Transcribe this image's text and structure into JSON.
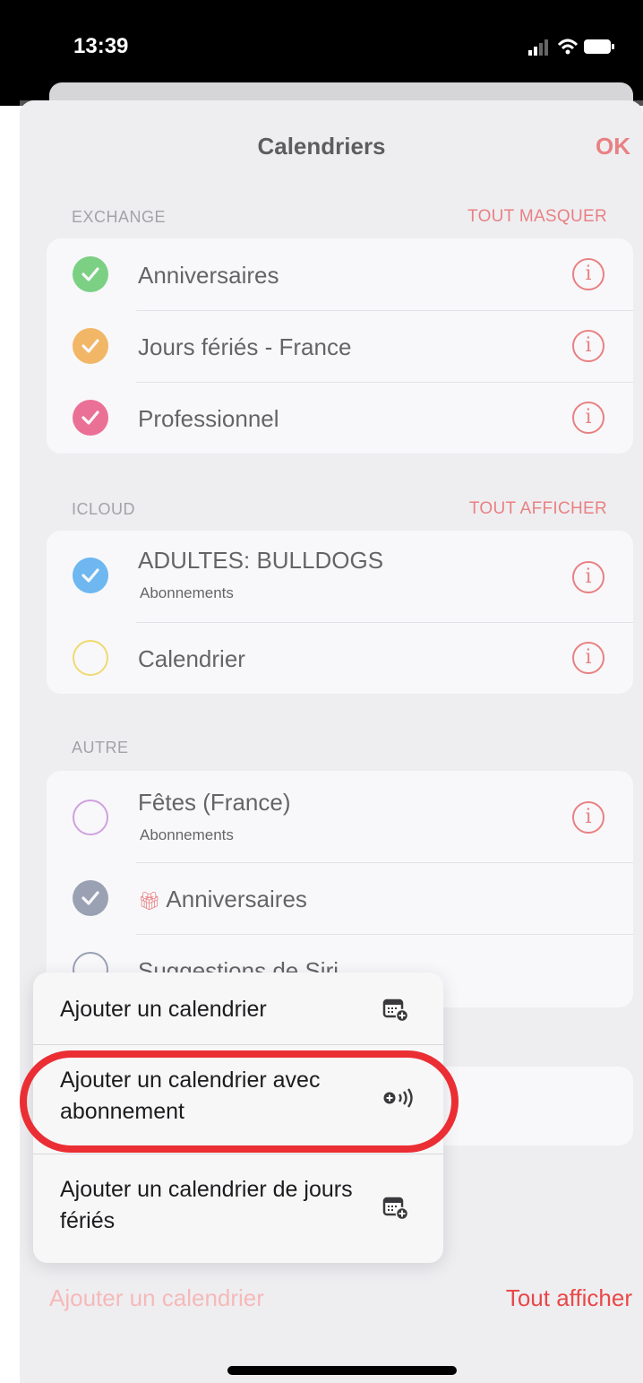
{
  "status_bar": {
    "time": "13:39"
  },
  "nav": {
    "title": "Calendriers",
    "done": "OK"
  },
  "sections": [
    {
      "header": "EXCHANGE",
      "action": "TOUT MASQUER",
      "items": [
        {
          "title": "Anniversaires",
          "color": "#3fc24a",
          "checked": true
        },
        {
          "title": "Jours fériés - France",
          "color": "#f59a1d",
          "checked": true
        },
        {
          "title": "Professionnel",
          "color": "#ec2f66",
          "checked": true
        }
      ]
    },
    {
      "header": "ICLOUD",
      "action": "TOUT AFFICHER",
      "items": [
        {
          "title": "ADULTES: BULLDOGS",
          "subtitle": "Abonnements",
          "color": "#2b9bf0",
          "checked": true
        },
        {
          "title": "Calendrier",
          "color": "#f2d12a",
          "checked": false
        }
      ]
    },
    {
      "header": "AUTRE",
      "items": [
        {
          "title": "Fêtes (France)",
          "subtitle": "Abonnements",
          "color": "#c07ad6",
          "checked": false
        },
        {
          "title": "Anniversaires",
          "color": "#6f7a92",
          "checked": true,
          "icon": "gift-icon"
        },
        {
          "title": "Suggestions de Siri",
          "color": "#6f7a92",
          "checked": false
        }
      ]
    }
  ],
  "menu": {
    "items": [
      {
        "label": "Ajouter un calendrier",
        "icon": "calendar-add-icon"
      },
      {
        "label": "Ajouter un calendrier avec abonnement",
        "icon": "subscription-add-icon",
        "highlighted": true
      },
      {
        "label": "Ajouter un calendrier de jours fériés",
        "icon": "calendar-add-icon"
      }
    ]
  },
  "footer": {
    "add_calendar": "Ajouter un calendrier",
    "show_all": "Tout afficher"
  },
  "colors": {
    "accent": "#e94848",
    "highlight_ring": "#ea2e34"
  }
}
